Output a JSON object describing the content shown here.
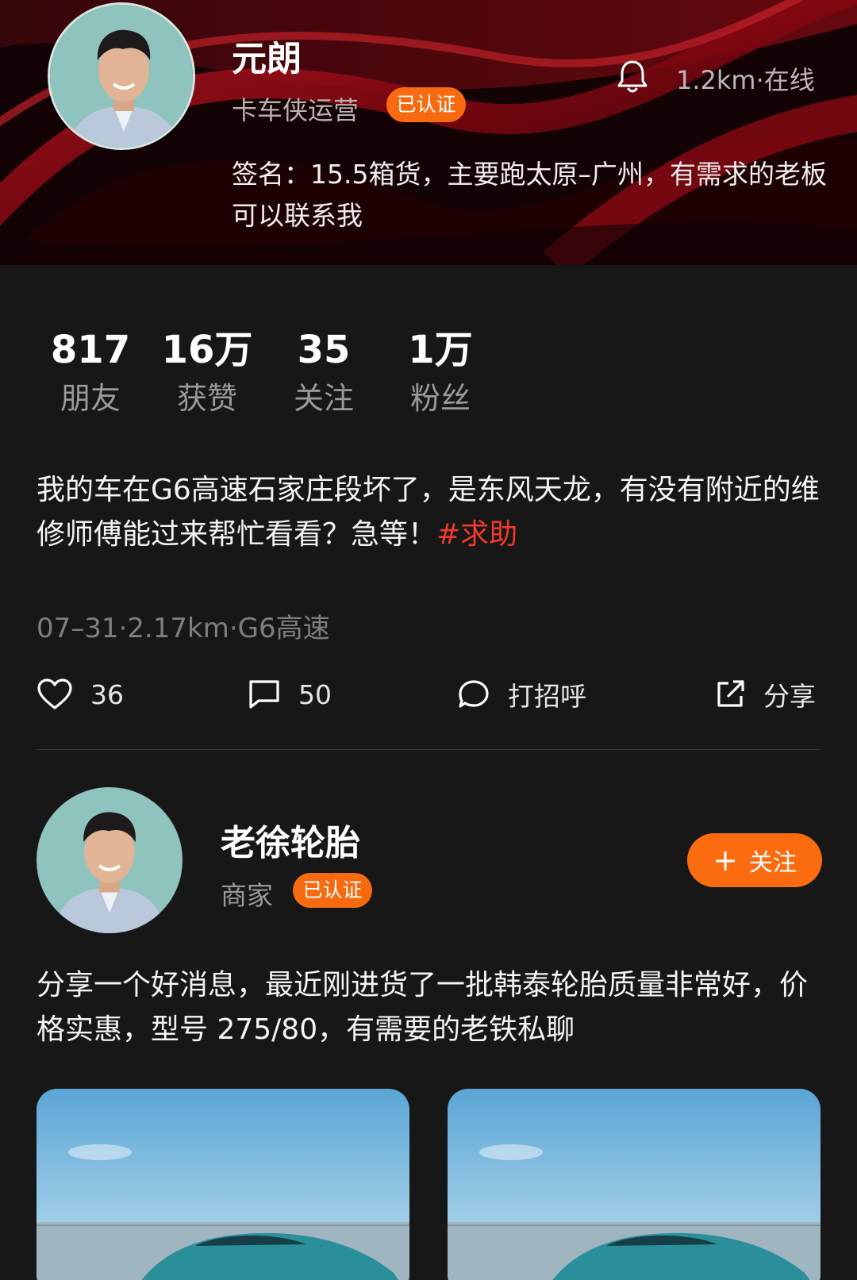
{
  "profile": {
    "name": "元朗",
    "role": "卡车侠运营",
    "verified_badge": "已认证",
    "distance_status": "1.2km·在线",
    "signature": "签名：15.5箱货，主要跑太原–广州，有需求的老板可以联系我"
  },
  "stats": [
    {
      "value": "817",
      "label": "朋友"
    },
    {
      "value": "16万",
      "label": "获赞"
    },
    {
      "value": "35",
      "label": "关注"
    },
    {
      "value": "1万",
      "label": "粉丝"
    }
  ],
  "post1": {
    "text": "我的车在G6高速石家庄段坏了，是东风天龙，有没有附近的维修师傅能过来帮忙看看？急等！",
    "hashtag": "#求助",
    "meta": "07–31·2.17km·G6高速",
    "actions": {
      "like_count": "36",
      "comment_count": "50",
      "greet_label": "打招呼",
      "share_label": "分享"
    }
  },
  "post2": {
    "author_name": "老徐轮胎",
    "author_role": "商家",
    "verified_badge": "已认证",
    "follow_label": "关注",
    "follow_icon": "+",
    "text": "分享一个好消息，最近刚进货了一批韩泰轮胎质量非常好，价格实惠，型号 275/80，有需要的老铁私聊"
  },
  "colors": {
    "accent": "#fb6c10",
    "hashtag": "#f23a2a",
    "background": "#171717",
    "header_red": "#c0101c"
  }
}
